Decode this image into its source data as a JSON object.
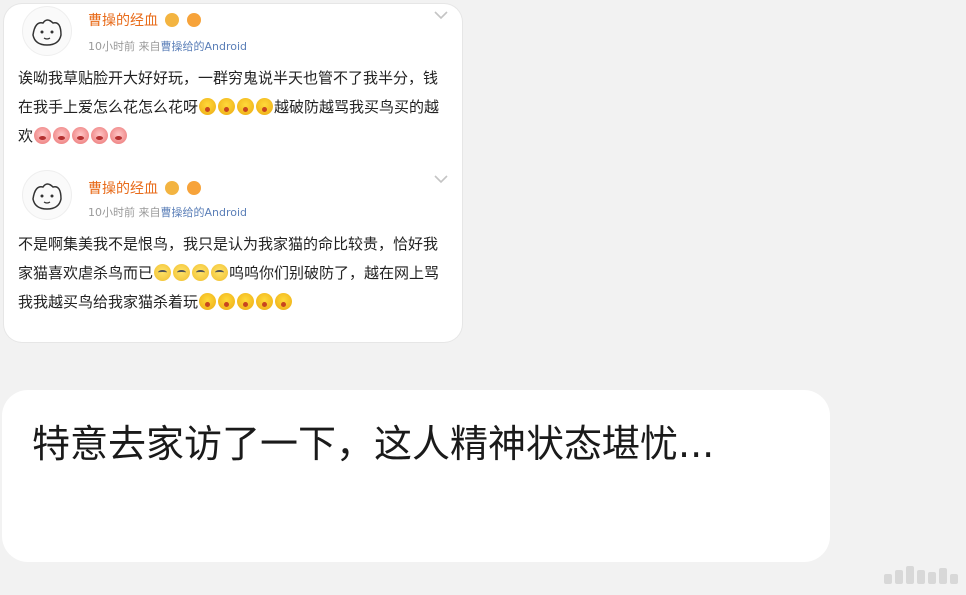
{
  "posts": [
    {
      "username": "曹操的经血",
      "time": "10小时前",
      "source_prefix": "来自",
      "source": "曹操给的Android",
      "segments": [
        {
          "t": "text",
          "v": "诶呦我草贴脸开大好好玩，一群穷鬼说半天也管不了我半分，钱在我手上爱怎么花怎么花呀"
        },
        {
          "t": "emoji",
          "v": "shock"
        },
        {
          "t": "emoji",
          "v": "shock"
        },
        {
          "t": "emoji",
          "v": "shock"
        },
        {
          "t": "emoji",
          "v": "shock"
        },
        {
          "t": "text",
          "v": "越破防越骂我买鸟买的越欢"
        },
        {
          "t": "emoji",
          "v": "angry"
        },
        {
          "t": "emoji",
          "v": "angry"
        },
        {
          "t": "emoji",
          "v": "angry"
        },
        {
          "t": "emoji",
          "v": "angry"
        },
        {
          "t": "emoji",
          "v": "angry"
        }
      ]
    },
    {
      "username": "曹操的经血",
      "time": "10小时前",
      "source_prefix": "来自",
      "source": "曹操给的Android",
      "segments": [
        {
          "t": "text",
          "v": "不是啊集美我不是恨鸟，我只是认为我家猫的命比较贵，恰好我家猫喜欢虐杀鸟而已"
        },
        {
          "t": "emoji",
          "v": "sweat"
        },
        {
          "t": "emoji",
          "v": "sweat"
        },
        {
          "t": "emoji",
          "v": "sweat"
        },
        {
          "t": "emoji",
          "v": "sweat"
        },
        {
          "t": "text",
          "v": "呜呜你们别破防了，越在网上骂我我越买鸟给我家猫杀着玩"
        },
        {
          "t": "emoji",
          "v": "shock"
        },
        {
          "t": "emoji",
          "v": "shock"
        },
        {
          "t": "emoji",
          "v": "shock"
        },
        {
          "t": "emoji",
          "v": "shock"
        },
        {
          "t": "emoji",
          "v": "shock"
        }
      ]
    }
  ],
  "message": {
    "text": "特意去家访了一下，这人精神状态堪忧..."
  },
  "colors": {
    "username": "#e86b1a",
    "source_link": "#5b7fb8",
    "page_bg": "#f2f2f2"
  },
  "icons": [
    "avatar-cartoon-cat-icon",
    "crown-badge-icon",
    "face-badge-icon",
    "chevron-down-icon",
    "shock-emoji-icon",
    "sweat-emoji-icon",
    "angry-emoji-icon"
  ]
}
